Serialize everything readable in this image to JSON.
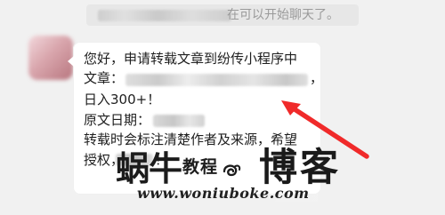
{
  "chat": {
    "system_notice_text": "在可以开始聊天了。",
    "message": {
      "line1": "您好，申请转载文章到纷传小程序中",
      "line2": "文章：",
      "line2_suffix": "，",
      "line3": "日入300+！",
      "line4": "原文日期：",
      "line5": "转载时会标注清楚作者及来源，希望",
      "line6": "授权，",
      "line6_suffix": "！"
    }
  },
  "watermark": {
    "left_text": "蜗牛",
    "brand_text": "教程",
    "title": "博客",
    "url": "www.woniuboke.com"
  },
  "icons": {
    "avatar": "avatar",
    "annotation_arrow": "red-arrow-icon",
    "watermark_mark": "swirl-icon"
  },
  "colors": {
    "background": "#f1f1f1",
    "bubble": "#ffffff",
    "text": "#202020",
    "notice_text": "#9a9a9a",
    "arrow_red": "#f02a2a",
    "watermark": "#1c1c1c"
  }
}
